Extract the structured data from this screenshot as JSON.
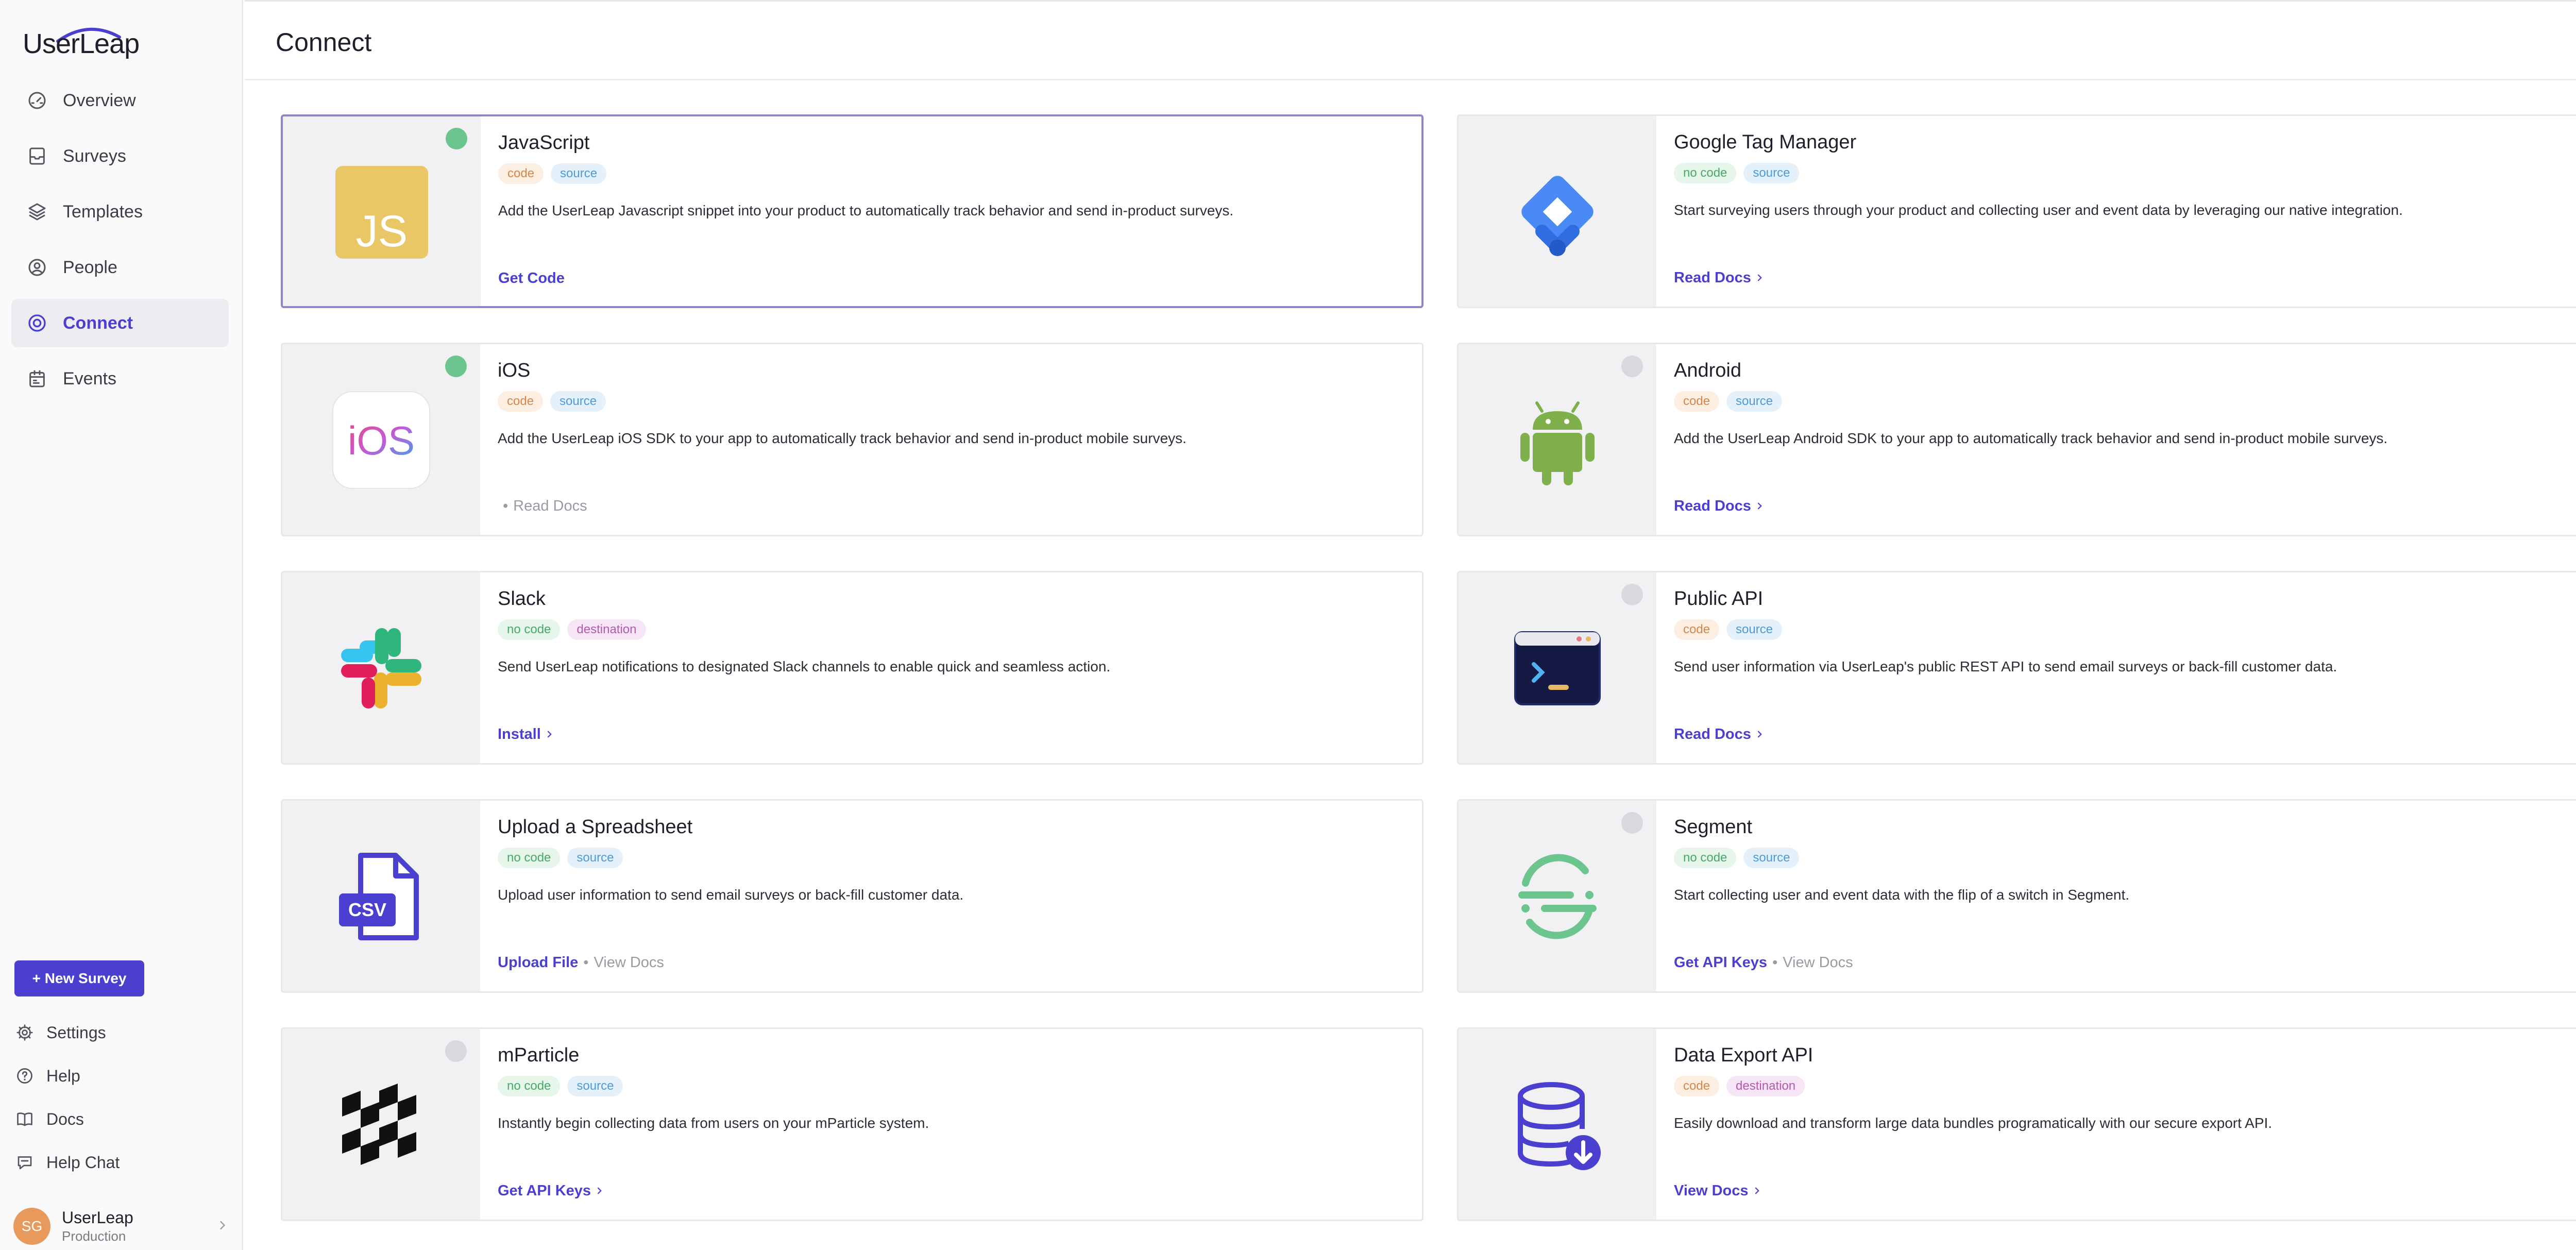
{
  "app": {
    "logo": "UserLeap"
  },
  "sidebar": {
    "items": [
      {
        "label": "Overview",
        "icon": "gauge-icon",
        "active": false
      },
      {
        "label": "Surveys",
        "icon": "inbox-icon",
        "active": false
      },
      {
        "label": "Templates",
        "icon": "layers-icon",
        "active": false
      },
      {
        "label": "People",
        "icon": "user-circle-icon",
        "active": false
      },
      {
        "label": "Connect",
        "icon": "target-icon",
        "active": true
      },
      {
        "label": "Events",
        "icon": "calendar-icon",
        "active": false
      }
    ],
    "new_survey_label": "+ New Survey",
    "bottom": [
      {
        "label": "Settings",
        "icon": "gear-icon"
      },
      {
        "label": "Help",
        "icon": "help-circle-icon"
      },
      {
        "label": "Docs",
        "icon": "book-icon"
      },
      {
        "label": "Help Chat",
        "icon": "chat-icon"
      }
    ],
    "account": {
      "initials": "SG",
      "name": "UserLeap",
      "env": "Production"
    }
  },
  "header": {
    "title": "Connect"
  },
  "integrations": [
    {
      "title": "JavaScript",
      "tags": [
        "code",
        "source"
      ],
      "desc": "Add the UserLeap Javascript snippet into your product to automatically track behavior and send in-product surveys.",
      "primary": "Get Code",
      "primary_chevron": false,
      "secondary": "",
      "status": "connected",
      "icon": "javascript-logo-icon",
      "selected": true
    },
    {
      "title": "Google Tag Manager",
      "tags": [
        "no code",
        "source"
      ],
      "desc": "Start surveying users through your product and collecting user and event data by leveraging our native integration.",
      "primary": "Read Docs",
      "primary_chevron": true,
      "secondary": "",
      "status": "none",
      "icon": "google-tag-manager-logo-icon",
      "selected": false
    },
    {
      "title": "iOS",
      "tags": [
        "code",
        "source"
      ],
      "desc": "Add the UserLeap iOS SDK to your app to automatically track behavior and send in-product mobile surveys.",
      "primary": "",
      "primary_chevron": false,
      "secondary": "Read Docs",
      "status": "connected",
      "icon": "ios-logo-icon",
      "selected": false
    },
    {
      "title": "Android",
      "tags": [
        "code",
        "source"
      ],
      "desc": "Add the UserLeap Android SDK to your app to automatically track behavior and send in-product mobile surveys.",
      "primary": "Read Docs",
      "primary_chevron": true,
      "secondary": "",
      "status": "disconnected",
      "icon": "android-logo-icon",
      "selected": false
    },
    {
      "title": "Slack",
      "tags": [
        "no code",
        "destination"
      ],
      "desc": "Send UserLeap notifications to designated Slack channels to enable quick and seamless action.",
      "primary": "Install",
      "primary_chevron": true,
      "secondary": "",
      "status": "none",
      "icon": "slack-logo-icon",
      "selected": false
    },
    {
      "title": "Public API",
      "tags": [
        "code",
        "source"
      ],
      "desc": "Send user information via UserLeap's public REST API to send email surveys or back-fill customer data.",
      "primary": "Read Docs",
      "primary_chevron": true,
      "secondary": "",
      "status": "disconnected",
      "icon": "terminal-window-icon",
      "selected": false
    },
    {
      "title": "Upload a Spreadsheet",
      "tags": [
        "no code",
        "source"
      ],
      "desc": "Upload user information to send email surveys or back-fill customer data.",
      "primary": "Upload File",
      "primary_chevron": false,
      "secondary": "View Docs",
      "status": "none",
      "icon": "csv-file-icon",
      "selected": false
    },
    {
      "title": "Segment",
      "tags": [
        "no code",
        "source"
      ],
      "desc": "Start collecting user and event data with the flip of a switch in Segment.",
      "primary": "Get API Keys",
      "primary_chevron": false,
      "secondary": "View Docs",
      "status": "disconnected",
      "icon": "segment-logo-icon",
      "selected": false
    },
    {
      "title": "mParticle",
      "tags": [
        "no code",
        "source"
      ],
      "desc": "Instantly begin collecting data from users on your mParticle system.",
      "primary": "Get API Keys",
      "primary_chevron": true,
      "secondary": "",
      "status": "disconnected",
      "icon": "mparticle-logo-icon",
      "selected": false
    },
    {
      "title": "Data Export API",
      "tags": [
        "code",
        "destination"
      ],
      "desc": "Easily download and transform large data bundles programatically with our secure export API.",
      "primary": "View Docs",
      "primary_chevron": true,
      "secondary": "",
      "status": "none",
      "icon": "database-download-icon",
      "selected": false
    }
  ],
  "colors": {
    "accent": "#4b3fd0",
    "connected": "#6cc58e",
    "sidebar_bg": "#fafafb"
  }
}
